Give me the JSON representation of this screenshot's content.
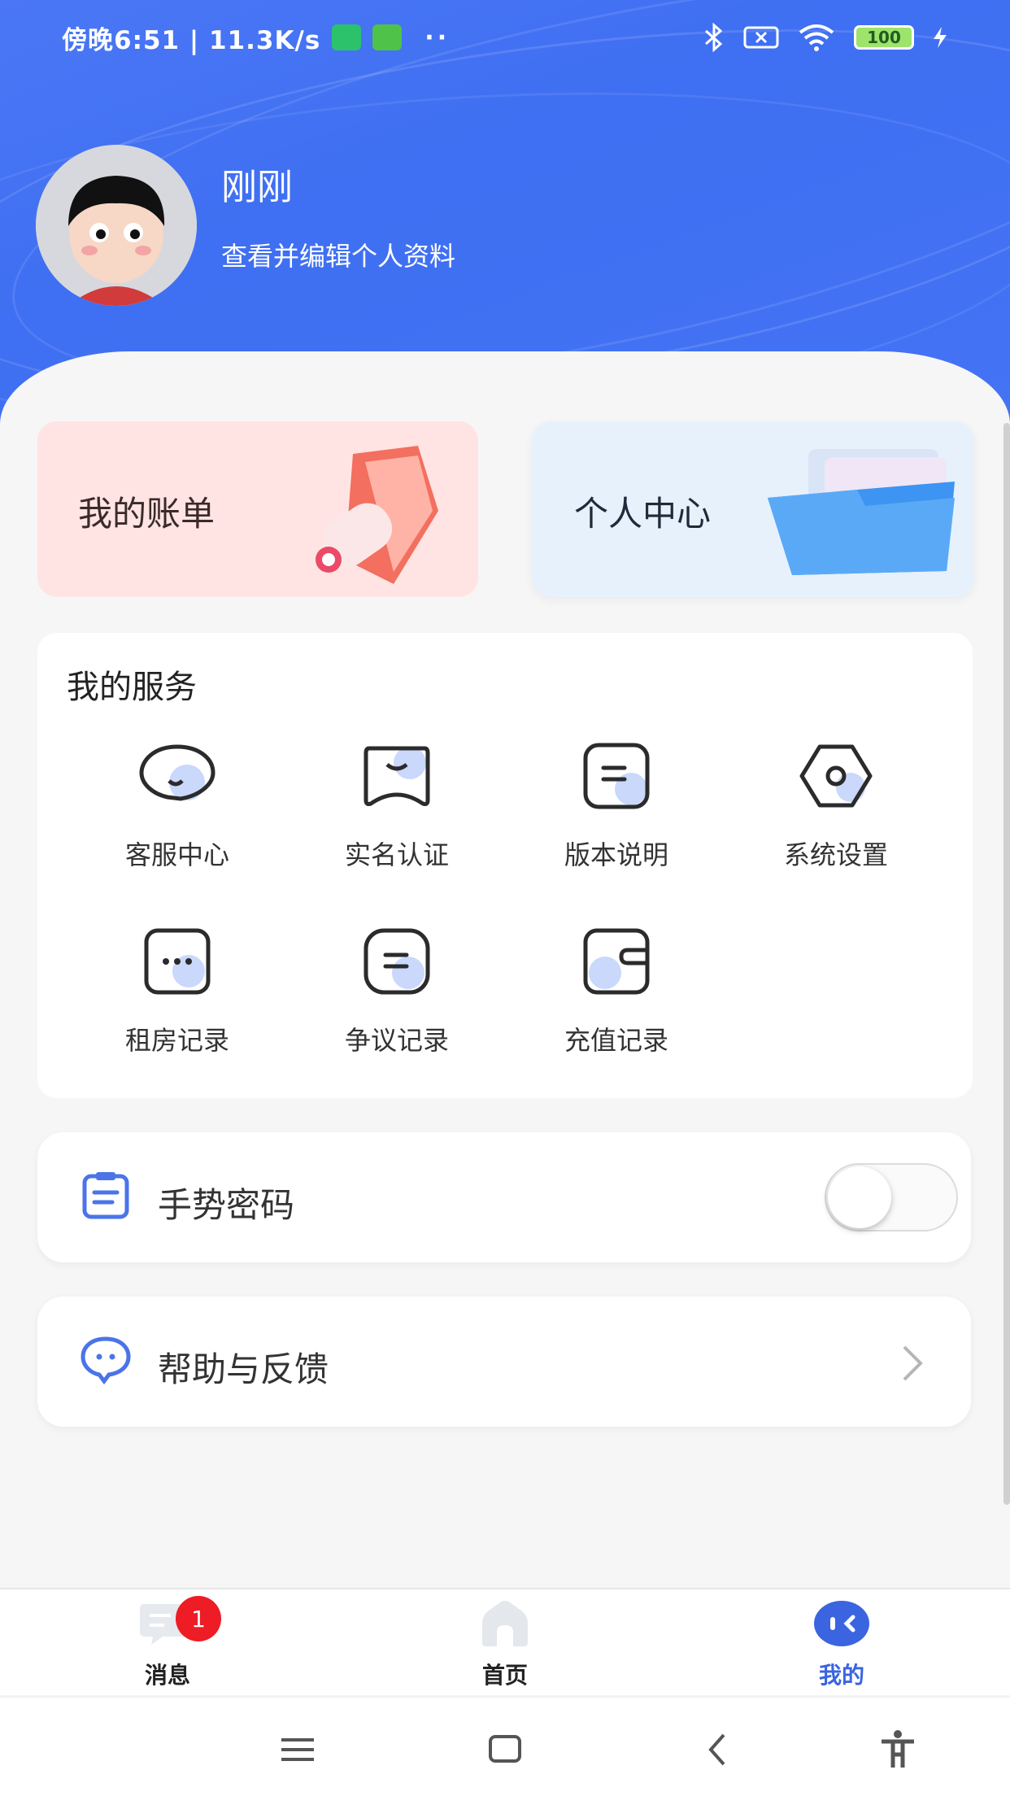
{
  "status_bar": {
    "time_speed": "傍晚6:51 | 11.3K/s",
    "more": "··",
    "battery": "100"
  },
  "profile": {
    "name": "刚刚",
    "edit_link": "查看并编辑个人资料"
  },
  "cards": {
    "bill": "我的账单",
    "center": "个人中心"
  },
  "services": {
    "title": "我的服务",
    "items": [
      {
        "label": "客服中心",
        "icon": "headset-icon"
      },
      {
        "label": "实名认证",
        "icon": "id-verify-icon"
      },
      {
        "label": "版本说明",
        "icon": "version-doc-icon"
      },
      {
        "label": "系统设置",
        "icon": "settings-icon"
      },
      {
        "label": "租房记录",
        "icon": "rent-record-icon"
      },
      {
        "label": "争议记录",
        "icon": "dispute-record-icon"
      },
      {
        "label": "充值记录",
        "icon": "wallet-icon"
      }
    ]
  },
  "rows": {
    "gesture": {
      "label": "手势密码",
      "enabled": false
    },
    "help": {
      "label": "帮助与反馈"
    }
  },
  "tabbar": {
    "tabs": [
      {
        "label": "消息",
        "badge": "1"
      },
      {
        "label": "首页"
      },
      {
        "label": "我的",
        "active": true
      }
    ]
  },
  "colors": {
    "accent": "#3f6ff2",
    "bill_card": "#ffe4e3",
    "center_card": "#e6f1fc",
    "badge": "#ee1c25"
  }
}
